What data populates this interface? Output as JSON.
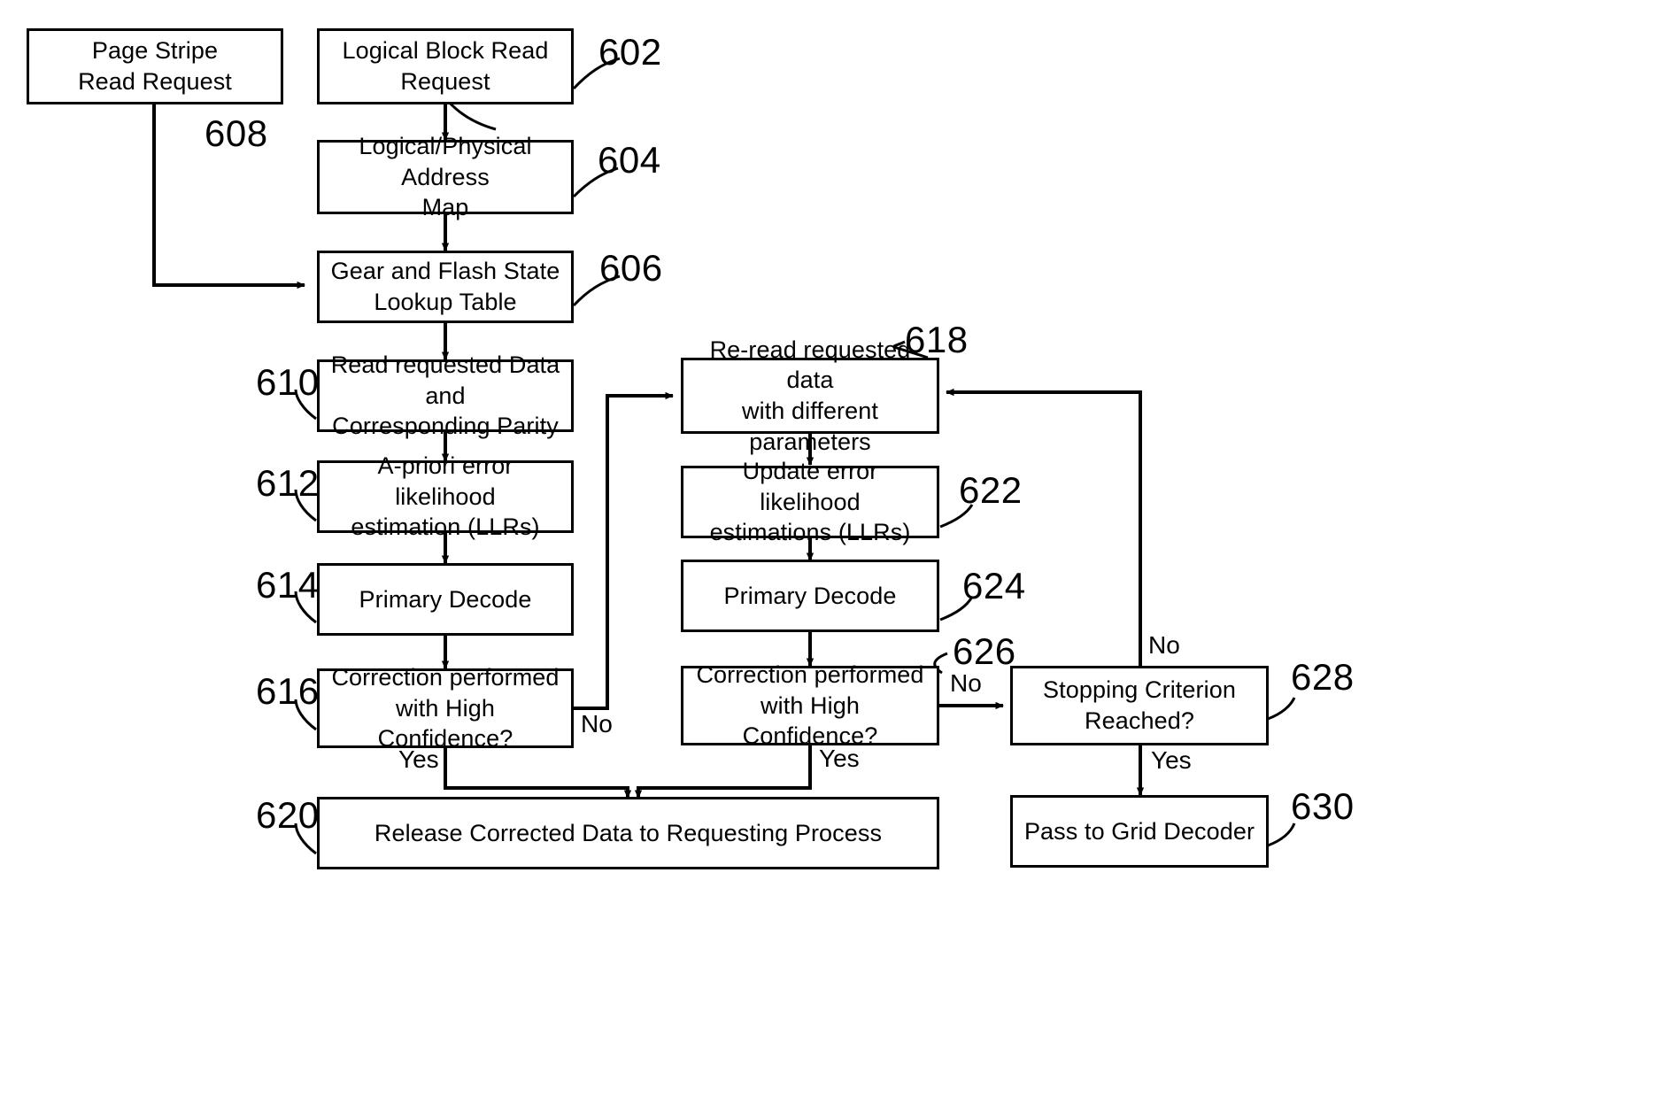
{
  "diagram": {
    "title": "Flash memory read and decode flowchart",
    "line_color": "#000000",
    "background": "#ffffff",
    "nodes": [
      {
        "id": "page_stripe_read_request",
        "label": "Page Stripe\nRead Request",
        "ref": "608"
      },
      {
        "id": "logical_block_read_request",
        "label": "Logical Block Read\nRequest",
        "ref": "602"
      },
      {
        "id": "logical_physical_address_map",
        "label": "Logical/Physical Address\nMap",
        "ref": "604"
      },
      {
        "id": "gear_and_flash_state_lookup_table",
        "label": "Gear and Flash State\nLookup Table",
        "ref": "606"
      },
      {
        "id": "read_requested_data_and_corresponding_parity",
        "label": "Read requested Data and\nCorresponding Parity",
        "ref": "610"
      },
      {
        "id": "a_priori_error_likelihood_estimation",
        "label": "A-priori error likelihood\nestimation (LLRs)",
        "ref": "612"
      },
      {
        "id": "primary_decode_left",
        "label": "Primary Decode",
        "ref": "614"
      },
      {
        "id": "correction_high_confidence_left",
        "label": "Correction performed\nwith High Confidence?",
        "ref": "616"
      },
      {
        "id": "re_read_requested_data",
        "label": "Re-read requested data\nwith different parameters",
        "ref": "618"
      },
      {
        "id": "update_error_likelihood_estimations",
        "label": "Update error likelihood\nestimations (LLRs)",
        "ref": "622"
      },
      {
        "id": "primary_decode_right",
        "label": "Primary Decode",
        "ref": "624"
      },
      {
        "id": "correction_high_confidence_right",
        "label": "Correction performed\nwith High Confidence?",
        "ref": "626"
      },
      {
        "id": "stopping_criterion_reached",
        "label": "Stopping Criterion\nReached?",
        "ref": "628"
      },
      {
        "id": "release_corrected_data",
        "label": "Release Corrected Data to Requesting Process",
        "ref": "620"
      },
      {
        "id": "pass_to_grid_decoder",
        "label": "Pass to Grid Decoder",
        "ref": "630"
      }
    ],
    "edge_labels": {
      "left_no": "No",
      "left_yes": "Yes",
      "right_no": "No",
      "right_yes": "Yes",
      "stopping_no": "No",
      "stopping_yes": "Yes"
    },
    "ref_numbers": {
      "n602": "602",
      "n604": "604",
      "n606": "606",
      "n608": "608",
      "n610": "610",
      "n612": "612",
      "n614": "614",
      "n616": "616",
      "n618": "618",
      "n620": "620",
      "n622": "622",
      "n624": "624",
      "n626": "626",
      "n628": "628",
      "n630": "630"
    },
    "node_text": {
      "page_stripe_read_request_l1": "Page Stripe",
      "page_stripe_read_request_l2": "Read Request",
      "logical_block_read_request_l1": "Logical Block Read",
      "logical_block_read_request_l2": "Request",
      "logical_physical_address_map_l1": "Logical/Physical Address",
      "logical_physical_address_map_l2": "Map",
      "gear_and_flash_state_lookup_table_l1": "Gear and Flash State",
      "gear_and_flash_state_lookup_table_l2": "Lookup Table",
      "read_requested_data_l1": "Read requested Data and",
      "read_requested_data_l2": "Corresponding Parity",
      "a_priori_l1": "A-priori error likelihood",
      "a_priori_l2": "estimation (LLRs)",
      "primary_decode_left": "Primary Decode",
      "correction_left_l1": "Correction performed",
      "correction_left_l2": "with High Confidence?",
      "re_read_l1": "Re-read requested data",
      "re_read_l2": "with different parameters",
      "update_llr_l1": "Update error likelihood",
      "update_llr_l2": "estimations (LLRs)",
      "primary_decode_right": "Primary Decode",
      "correction_right_l1": "Correction performed",
      "correction_right_l2": "with High Confidence?",
      "stopping_l1": "Stopping Criterion",
      "stopping_l2": "Reached?",
      "release_corrected_data": "Release Corrected Data to Requesting Process",
      "pass_to_grid_decoder": "Pass to Grid Decoder"
    }
  }
}
